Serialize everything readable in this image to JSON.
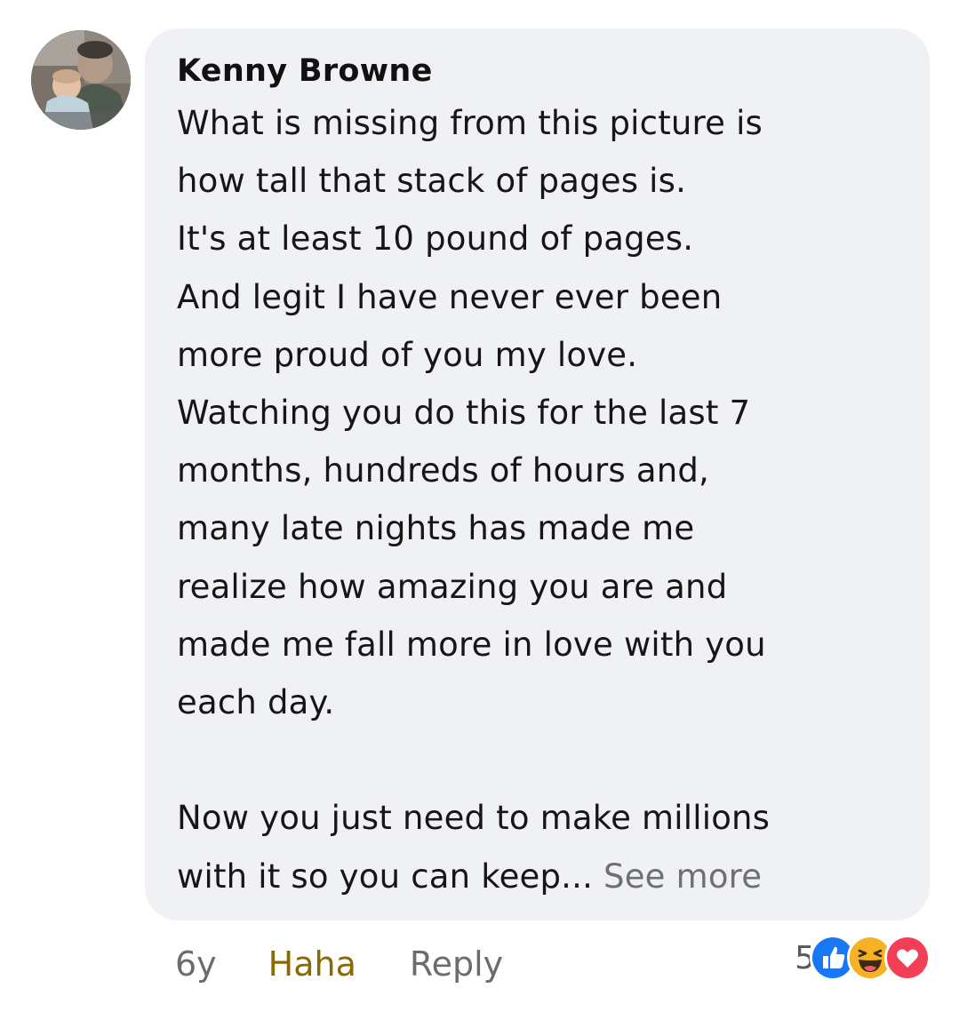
{
  "comment": {
    "author": "Kenny Browne",
    "lines": [
      "What is missing from this picture is",
      "how tall that stack of pages is.",
      "It's at least 10 pound of pages.",
      "And legit I have never ever been",
      "more proud of you my love.",
      "Watching you do this for the last 7",
      "months, hundreds of hours and,",
      "many late nights has made me",
      "realize how amazing you are and",
      "made me fall more in love with you",
      "each day."
    ],
    "lines_2": [
      "Now you just need to make millions",
      "with it so you can keep..."
    ],
    "see_more": "See more"
  },
  "actions": {
    "time": "6y",
    "reaction_label": "Haha",
    "reply_label": "Reply"
  },
  "reactions": {
    "count": "5",
    "icons": [
      "like-icon",
      "haha-icon",
      "love-icon"
    ],
    "colors": {
      "like": "#1877f2",
      "haha": "#f7b125",
      "love": "#f33e58",
      "haha_label": "#8a6a00"
    }
  }
}
